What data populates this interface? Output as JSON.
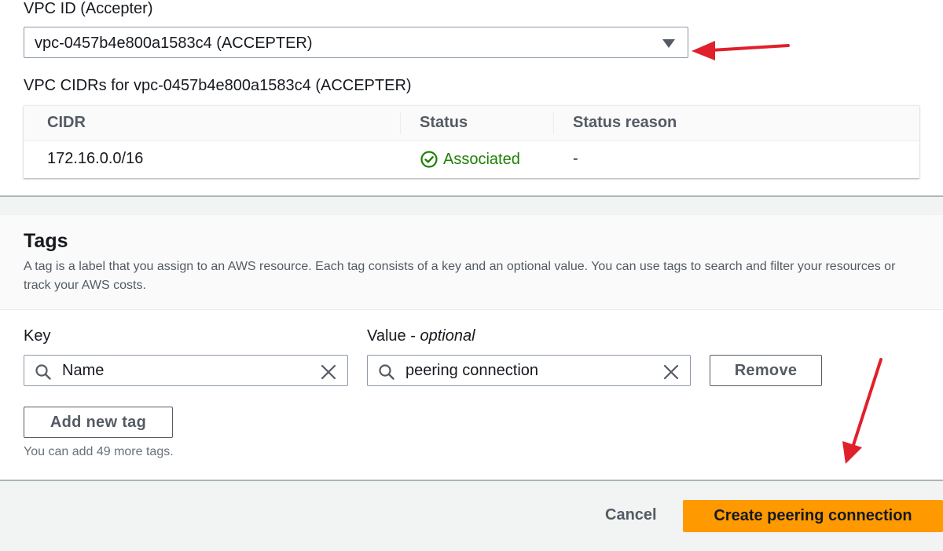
{
  "accepter": {
    "vpc_label": "VPC ID (Accepter)",
    "vpc_selected": "vpc-0457b4e800a1583c4 (ACCEPTER)",
    "cidrs_label": "VPC CIDRs for vpc-0457b4e800a1583c4 (ACCEPTER)",
    "table": {
      "columns": [
        "CIDR",
        "Status",
        "Status reason"
      ],
      "rows": [
        {
          "cidr": "172.16.0.0/16",
          "status": "Associated",
          "status_reason": "-"
        }
      ]
    }
  },
  "tags": {
    "title": "Tags",
    "description": "A tag is a label that you assign to an AWS resource. Each tag consists of a key and an optional value. You can use tags to search and filter your resources or track your AWS costs.",
    "key_label": "Key",
    "value_label": "Value - ",
    "value_label_suffix": "optional",
    "key_value": "Name",
    "value_value": "peering connection",
    "remove_label": "Remove",
    "add_label": "Add new tag",
    "hint": "You can add 49 more tags."
  },
  "footer": {
    "cancel_label": "Cancel",
    "create_label": "Create peering connection"
  },
  "icons": {
    "dropdown": "caret-down-icon",
    "status": "check-circle-icon",
    "search": "search-icon",
    "clear": "close-icon"
  },
  "colors": {
    "primary": "#ff9900",
    "success": "#1d8102",
    "annotation": "#e0202a"
  }
}
